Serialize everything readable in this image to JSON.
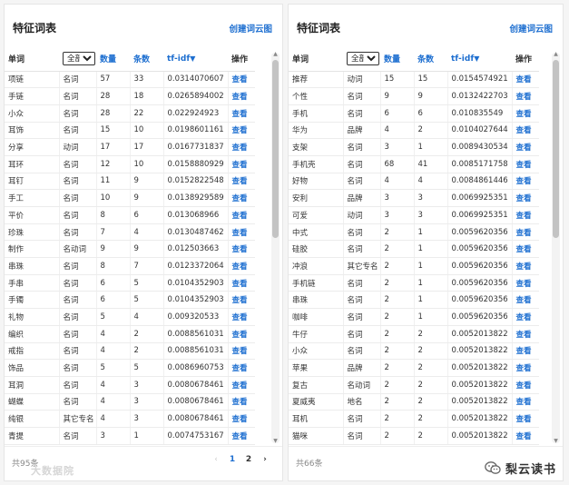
{
  "panels": [
    {
      "title": "特征词表",
      "action_link": "创建词云图",
      "columns": {
        "word": "单词",
        "pos_select": "全部",
        "count": "数量",
        "docs": "条数",
        "tfidf": "tf-idf",
        "sort_arrow": "▼",
        "action": "操作"
      },
      "rows": [
        [
          "项链",
          "名词",
          "57",
          "33",
          "0.0314070607",
          "查看"
        ],
        [
          "手链",
          "名词",
          "28",
          "18",
          "0.0265894002",
          "查看"
        ],
        [
          "小众",
          "名词",
          "28",
          "22",
          "0.022924923",
          "查看"
        ],
        [
          "耳饰",
          "名词",
          "15",
          "10",
          "0.0198601161",
          "查看"
        ],
        [
          "分享",
          "动词",
          "17",
          "17",
          "0.0167731837",
          "查看"
        ],
        [
          "耳环",
          "名词",
          "12",
          "10",
          "0.0158880929",
          "查看"
        ],
        [
          "耳钉",
          "名词",
          "11",
          "9",
          "0.0152822548",
          "查看"
        ],
        [
          "手工",
          "名词",
          "10",
          "9",
          "0.0138929589",
          "查看"
        ],
        [
          "平价",
          "名词",
          "8",
          "6",
          "0.013068966",
          "查看"
        ],
        [
          "珍珠",
          "名词",
          "7",
          "4",
          "0.0130487462",
          "查看"
        ],
        [
          "制作",
          "名动词",
          "9",
          "9",
          "0.012503663",
          "查看"
        ],
        [
          "串珠",
          "名词",
          "8",
          "7",
          "0.0123372064",
          "查看"
        ],
        [
          "手串",
          "名词",
          "6",
          "5",
          "0.0104352903",
          "查看"
        ],
        [
          "手镯",
          "名词",
          "6",
          "5",
          "0.0104352903",
          "查看"
        ],
        [
          "礼物",
          "名词",
          "5",
          "4",
          "0.009320533",
          "查看"
        ],
        [
          "编织",
          "名词",
          "4",
          "2",
          "0.0088561031",
          "查看"
        ],
        [
          "戒指",
          "名词",
          "4",
          "2",
          "0.0088561031",
          "查看"
        ],
        [
          "饰品",
          "名词",
          "5",
          "5",
          "0.0086960753",
          "查看"
        ],
        [
          "耳洞",
          "名词",
          "4",
          "3",
          "0.0080678461",
          "查看"
        ],
        [
          "蝴蝶",
          "名词",
          "4",
          "3",
          "0.0080678461",
          "查看"
        ],
        [
          "纯银",
          "其它专名",
          "4",
          "3",
          "0.0080678461",
          "查看"
        ],
        [
          "青提",
          "名词",
          "3",
          "1",
          "0.0074753167",
          "查看"
        ]
      ],
      "total": "共95条",
      "pager": {
        "prev": "‹",
        "pages": [
          "1",
          "2"
        ],
        "next": "›"
      }
    },
    {
      "title": "特征词表",
      "action_link": "创建词云图",
      "columns": {
        "word": "单词",
        "pos_select": "全部",
        "count": "数量",
        "docs": "条数",
        "tfidf": "tf-idf",
        "sort_arrow": "▼",
        "action": "操作"
      },
      "rows": [
        [
          "推荐",
          "动词",
          "15",
          "15",
          "0.0154574921",
          "查看"
        ],
        [
          "个性",
          "名词",
          "9",
          "9",
          "0.0132422703",
          "查看"
        ],
        [
          "手机",
          "名词",
          "6",
          "6",
          "0.010835549",
          "查看"
        ],
        [
          "华为",
          "品牌",
          "4",
          "2",
          "0.0104027644",
          "查看"
        ],
        [
          "支架",
          "名词",
          "3",
          "1",
          "0.0089430534",
          "查看"
        ],
        [
          "手机壳",
          "名词",
          "68",
          "41",
          "0.0085171758",
          "查看"
        ],
        [
          "好物",
          "名词",
          "4",
          "4",
          "0.0084861446",
          "查看"
        ],
        [
          "安利",
          "品牌",
          "3",
          "3",
          "0.0069925351",
          "查看"
        ],
        [
          "可爱",
          "动词",
          "3",
          "3",
          "0.0069925351",
          "查看"
        ],
        [
          "中式",
          "名词",
          "2",
          "1",
          "0.0059620356",
          "查看"
        ],
        [
          "硅胶",
          "名词",
          "2",
          "1",
          "0.0059620356",
          "查看"
        ],
        [
          "冲浪",
          "其它专名",
          "2",
          "1",
          "0.0059620356",
          "查看"
        ],
        [
          "手机链",
          "名词",
          "2",
          "1",
          "0.0059620356",
          "查看"
        ],
        [
          "串珠",
          "名词",
          "2",
          "1",
          "0.0059620356",
          "查看"
        ],
        [
          "咖啡",
          "名词",
          "2",
          "1",
          "0.0059620356",
          "查看"
        ],
        [
          "牛仔",
          "名词",
          "2",
          "2",
          "0.0052013822",
          "查看"
        ],
        [
          "小众",
          "名词",
          "2",
          "2",
          "0.0052013822",
          "查看"
        ],
        [
          "苹果",
          "品牌",
          "2",
          "2",
          "0.0052013822",
          "查看"
        ],
        [
          "复古",
          "名动词",
          "2",
          "2",
          "0.0052013822",
          "查看"
        ],
        [
          "夏威夷",
          "地名",
          "2",
          "2",
          "0.0052013822",
          "查看"
        ],
        [
          "耳机",
          "名词",
          "2",
          "2",
          "0.0052013822",
          "查看"
        ],
        [
          "猫咪",
          "名词",
          "2",
          "2",
          "0.0052013822",
          "查看"
        ]
      ],
      "total": "共66条"
    }
  ],
  "watermark": "大数据院",
  "wechat_label": "梨云读书",
  "accent_color": "#1e6fd0"
}
